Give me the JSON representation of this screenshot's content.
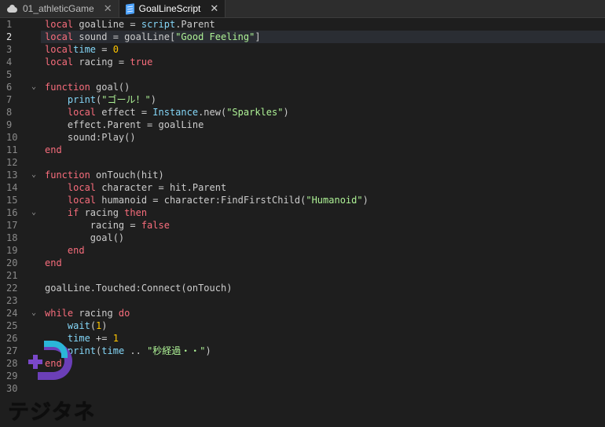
{
  "tabs": [
    {
      "label": "01_athleticGame",
      "icon": "cloud-icon",
      "active": false
    },
    {
      "label": "GoalLineScript",
      "icon": "script-icon",
      "active": true
    }
  ],
  "editor": {
    "current_line": 2,
    "folds": [
      6,
      13,
      16,
      24
    ],
    "lines": [
      [
        [
          "kw",
          "local"
        ],
        [
          "",
          "goalLine = "
        ],
        [
          "blt",
          "script"
        ],
        [
          "",
          ".Parent"
        ]
      ],
      [
        [
          "kw",
          "local"
        ],
        [
          "",
          "sound = goalLine["
        ],
        [
          "str",
          "\"Good Feeling\""
        ],
        [
          "",
          "]"
        ]
      ],
      [
        [
          "kw",
          "local"
        ],
        [
          "",
          ""
        ],
        [
          "blt",
          "time"
        ],
        [
          "",
          " = "
        ],
        [
          "num",
          "0"
        ]
      ],
      [
        [
          "kw",
          "local"
        ],
        [
          "",
          "racing = "
        ],
        [
          "kw",
          "true"
        ]
      ],
      [],
      [
        [
          "kw",
          "function"
        ],
        [
          "",
          " goal()"
        ]
      ],
      [
        [
          "",
          "    "
        ],
        [
          "blt",
          "print"
        ],
        [
          "",
          "("
        ],
        [
          "str",
          "\"ゴール！\""
        ],
        [
          "",
          ")"
        ]
      ],
      [
        [
          "",
          "    "
        ],
        [
          "kw",
          "local"
        ],
        [
          "",
          " effect = "
        ],
        [
          "blt",
          "Instance"
        ],
        [
          "",
          ".new("
        ],
        [
          "str",
          "\"Sparkles\""
        ],
        [
          "",
          ")"
        ]
      ],
      [
        [
          "",
          "    effect.Parent = goalLine"
        ]
      ],
      [
        [
          "",
          "    sound:Play()"
        ]
      ],
      [
        [
          "kw",
          "end"
        ]
      ],
      [],
      [
        [
          "kw",
          "function"
        ],
        [
          "",
          " onTouch(hit)"
        ]
      ],
      [
        [
          "",
          "    "
        ],
        [
          "kw",
          "local"
        ],
        [
          "",
          " character = hit.Parent"
        ]
      ],
      [
        [
          "",
          "    "
        ],
        [
          "kw",
          "local"
        ],
        [
          "",
          " humanoid = character:FindFirstChild("
        ],
        [
          "str",
          "\"Humanoid\""
        ],
        [
          "",
          ")"
        ]
      ],
      [
        [
          "",
          "    "
        ],
        [
          "kw",
          "if"
        ],
        [
          "",
          " racing "
        ],
        [
          "kw",
          "then"
        ]
      ],
      [
        [
          "",
          "        racing = "
        ],
        [
          "kw",
          "false"
        ]
      ],
      [
        [
          "",
          "        goal()"
        ]
      ],
      [
        [
          "",
          "    "
        ],
        [
          "kw",
          "end"
        ]
      ],
      [
        [
          "kw",
          "end"
        ]
      ],
      [],
      [
        [
          "",
          "goalLine.Touched:Connect(onTouch)"
        ]
      ],
      [],
      [
        [
          "kw",
          "while"
        ],
        [
          "",
          " racing "
        ],
        [
          "kw",
          "do"
        ]
      ],
      [
        [
          "",
          "    "
        ],
        [
          "blt",
          "wait"
        ],
        [
          "",
          "("
        ],
        [
          "num",
          "1"
        ],
        [
          "",
          ")"
        ]
      ],
      [
        [
          "",
          "    "
        ],
        [
          "blt",
          "time"
        ],
        [
          "",
          " += "
        ],
        [
          "num",
          "1"
        ]
      ],
      [
        [
          "",
          "    "
        ],
        [
          "blt",
          "print"
        ],
        [
          "",
          "("
        ],
        [
          "blt",
          "time"
        ],
        [
          "",
          " .. "
        ],
        [
          "str",
          "\"秒経過・・\""
        ],
        [
          "",
          ")"
        ]
      ],
      [
        [
          "kw",
          "end"
        ]
      ],
      [],
      []
    ]
  },
  "watermark": {
    "text": "テジタネ"
  },
  "colors": {
    "background": "#1e1e1e",
    "keyword": "#f86d7c",
    "builtin": "#84d6f7",
    "string": "#adf195",
    "number": "#ffc600",
    "text": "#cccccc",
    "current_line": "#2a2d33"
  }
}
